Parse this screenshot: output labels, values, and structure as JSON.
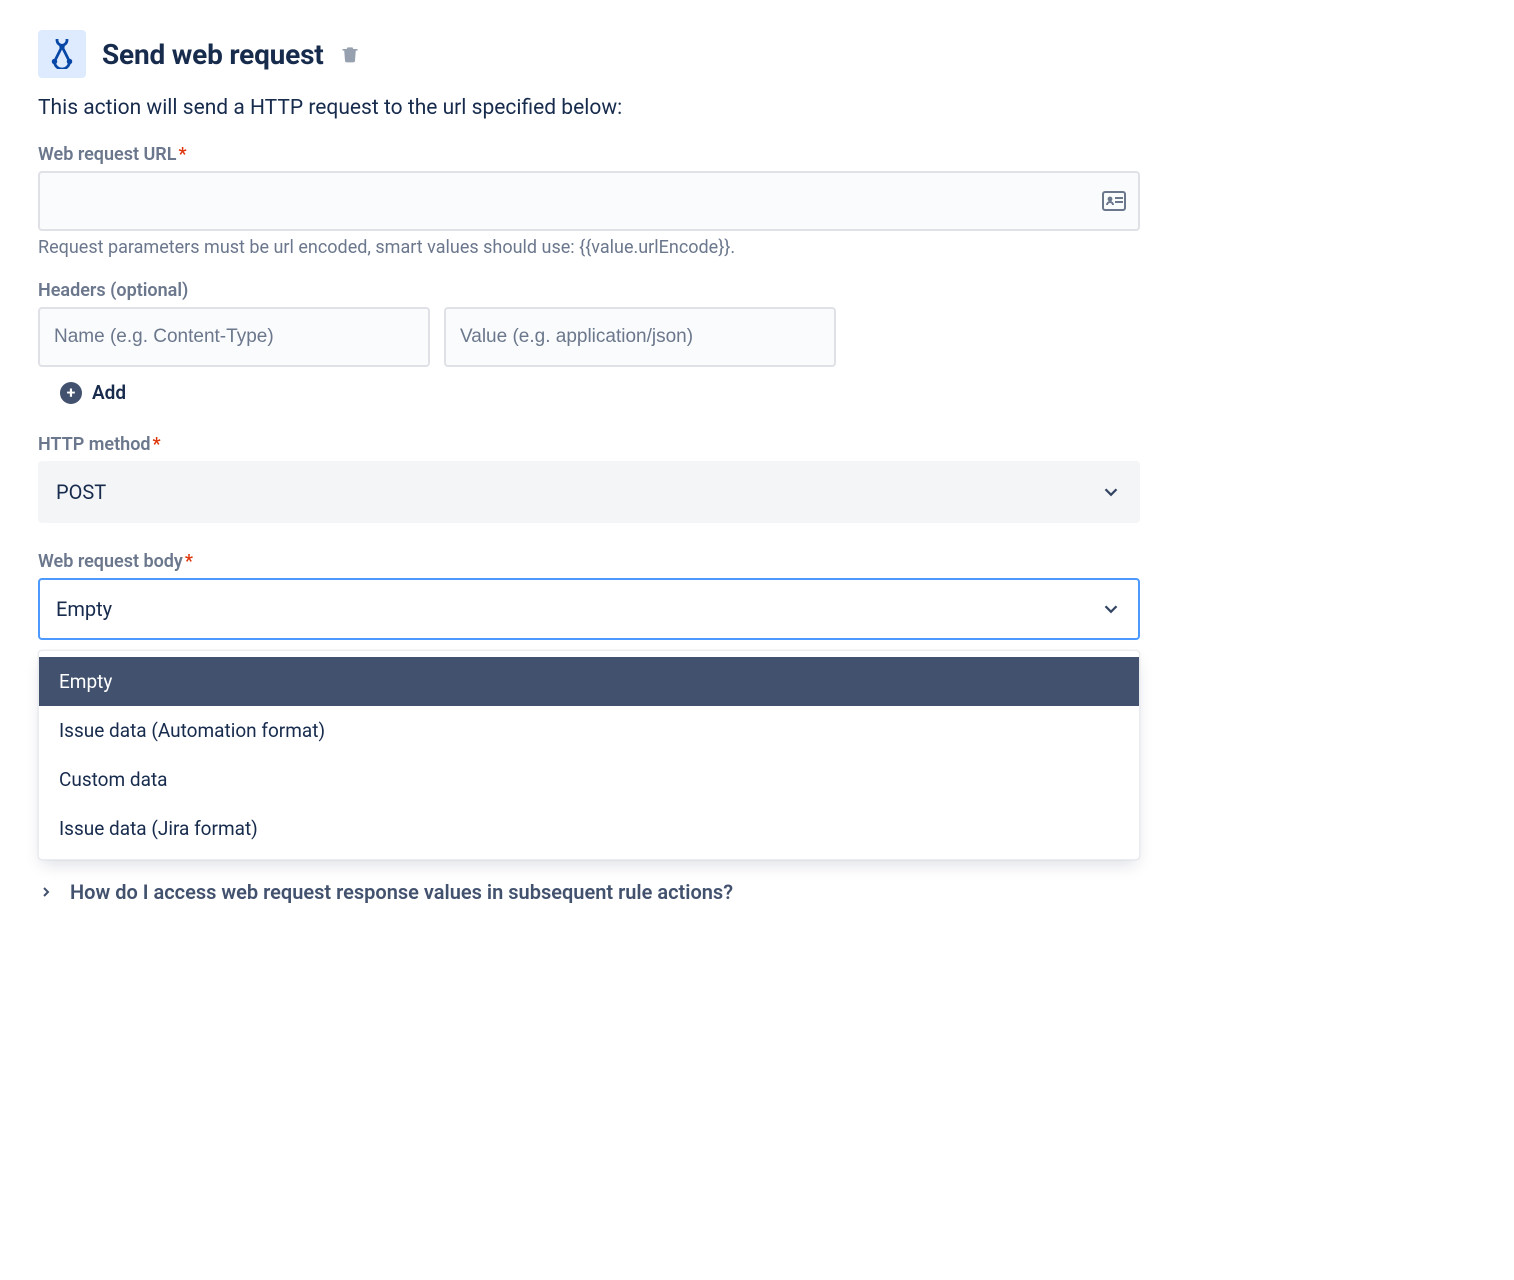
{
  "header": {
    "title": "Send web request"
  },
  "description": "This action will send a HTTP request to the url specified below:",
  "url_field": {
    "label": "Web request URL",
    "value": "",
    "helper": "Request parameters must be url encoded, smart values should use: {{value.urlEncode}}."
  },
  "headers_field": {
    "label": "Headers (optional)",
    "name_placeholder": "Name (e.g. Content-Type)",
    "value_placeholder": "Value (e.g. application/json)",
    "add_label": "Add"
  },
  "method_field": {
    "label": "HTTP method",
    "value": "POST"
  },
  "body_field": {
    "label": "Web request body",
    "value": "Empty",
    "options": [
      "Empty",
      "Issue data (Automation format)",
      "Custom data",
      "Issue data (Jira format)"
    ]
  },
  "expander": {
    "label": "How do I access web request response values in subsequent rule actions?"
  }
}
